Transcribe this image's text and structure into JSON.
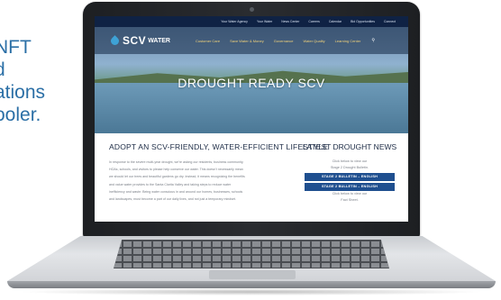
{
  "side_text": [
    "NFT",
    "d",
    "ations",
    "ooler."
  ],
  "site": {
    "topbar_links": [
      "Your Water Agency",
      "Your Water",
      "News Center",
      "Careers",
      "Calendar",
      "Bid Opportunities",
      "Connect"
    ],
    "logo": {
      "scv": "SCV",
      "water": "WATER"
    },
    "nav_items": [
      "Customer Care",
      "Save Water & Money",
      "Governance",
      "Water Quality",
      "Learning Center"
    ],
    "search_icon": "search-icon",
    "hero_title": "DROUGHT READY SCV",
    "left": {
      "heading": "ADOPT AN SCV-FRIENDLY, WATER-EFFICIENT LIFESTYLE",
      "paragraph_lines": [
        "In response to the severe multi-year drought, we're asking our residents, business community,",
        "HOAs, schools, and visitors to please help conserve our water. This doesn't necessarily mean",
        "we should let our trees and beautiful gardens go dry. Instead, it means recognizing the benefits",
        "and value water provides to the Santa Clarita Valley and taking steps to reduce water",
        "inefficiency and waste. Being water conscious in and around our homes, businesses, schools",
        "and landscapes, must become a part of our daily lives, and not just a temporary mindset."
      ]
    },
    "right": {
      "heading": "LATEST DROUGHT NEWS",
      "intro_1": "Click below to view our",
      "intro_2": "Stage 2 Drought Bulletin.",
      "btn1": "STAGE 2 BULLETIN – ENGLISH",
      "btn2": "STAGE 2 BULLETIN – ENGLISH",
      "outro_1": "Click below to view our",
      "outro_2": "Fact Sheet."
    }
  },
  "colors": {
    "accent": "#1f4f8f",
    "topbar": "#0f2244",
    "nav_text": "#f2d27a",
    "side_text": "#2b6fa6"
  }
}
